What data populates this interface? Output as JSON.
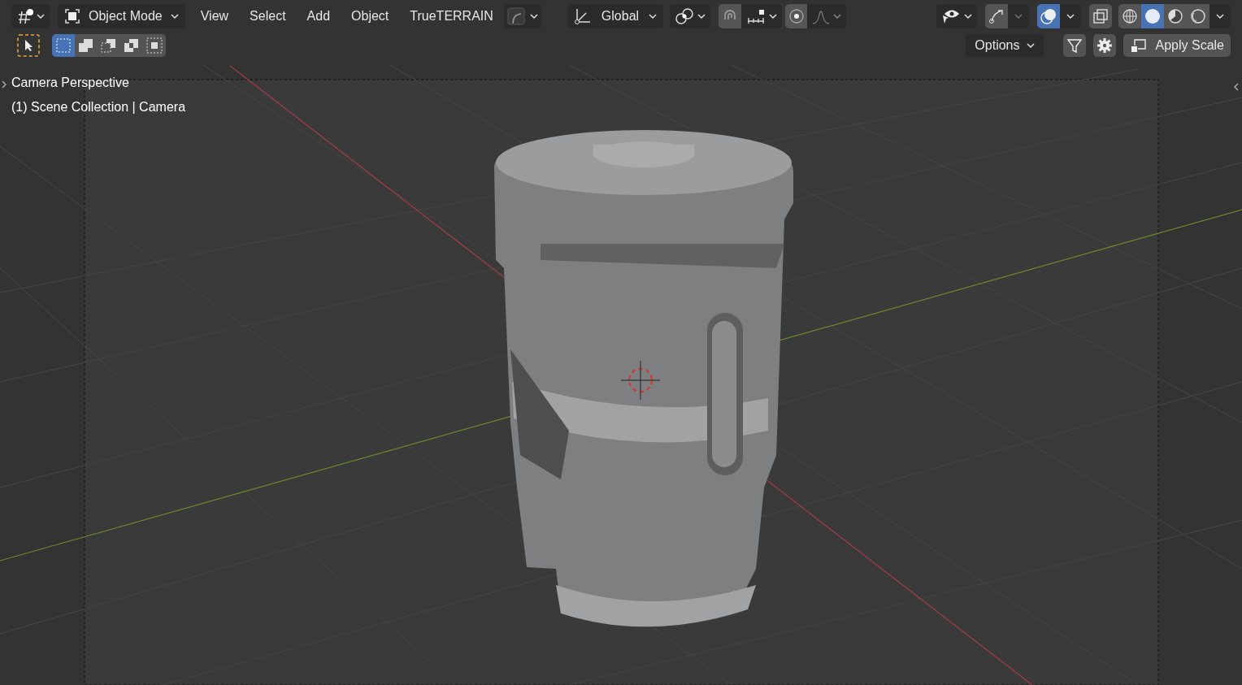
{
  "header": {
    "mode_menu": {
      "label": "Object Mode"
    },
    "menus": [
      "View",
      "Select",
      "Add",
      "Object",
      "TrueTERRAIN"
    ],
    "transform_orientation": {
      "label": "Global"
    },
    "snap": {
      "on": true
    },
    "proportional_editing": {
      "on": true
    },
    "overlays": {
      "on": true
    },
    "shading_modes": [
      {
        "kind": "wireframe",
        "selected": false
      },
      {
        "kind": "solid",
        "selected": true
      },
      {
        "kind": "material",
        "selected": false
      },
      {
        "kind": "rendered",
        "selected": false
      }
    ]
  },
  "tool_header": {
    "select_modes": [
      {
        "kind": "new",
        "selected": true
      },
      {
        "kind": "extend",
        "selected": false
      },
      {
        "kind": "subtract",
        "selected": false
      },
      {
        "kind": "invert",
        "selected": false
      },
      {
        "kind": "intersect",
        "selected": false
      }
    ],
    "options": {
      "label": "Options"
    },
    "apply_button": {
      "label": "Apply Scale"
    }
  },
  "viewport": {
    "view_name": "Camera Perspective",
    "object_info": "(1) Scene Collection | Camera"
  }
}
